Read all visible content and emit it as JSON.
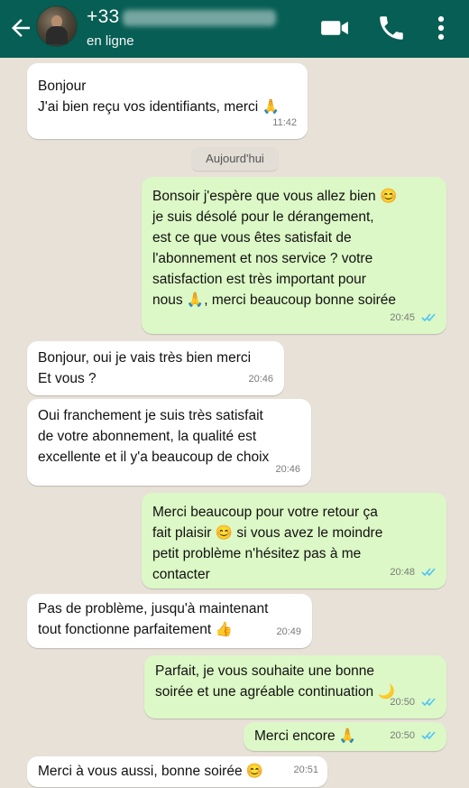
{
  "header": {
    "contact_name": "+33",
    "status": "en ligne"
  },
  "date_separator": "Aujourd'hui",
  "messages": [
    {
      "dir": "in",
      "text": "Bonjour\nJ'ai bien reçu vos identifiants, merci 🙏",
      "time": "11:42"
    },
    {
      "dir": "out",
      "text": "Bonsoir j'espère que vous allez bien 😊\nje suis désolé pour le dérangement,\nest ce que vous êtes satisfait de\nl'abonnement et nos service ? votre\nsatisfaction est très important pour\nnous 🙏, merci beaucoup bonne soirée",
      "time": "20:45"
    },
    {
      "dir": "in",
      "text": "Bonjour, oui je vais très bien merci\nEt vous ?",
      "time": "20:46"
    },
    {
      "dir": "in",
      "text": "Oui franchement je suis très satisfait\nde votre abonnement, la qualité est\nexcellente et il y'a beaucoup de choix",
      "time": "20:46"
    },
    {
      "dir": "out",
      "text": "Merci beaucoup pour votre retour ça\nfait plaisir 😊 si vous avez le moindre\npetit problème n'hésitez pas à me\ncontacter",
      "time": "20:48"
    },
    {
      "dir": "in",
      "text": "Pas de problème, jusqu'à maintenant\ntout fonctionne parfaitement 👍",
      "time": "20:49"
    },
    {
      "dir": "out",
      "text": "Parfait, je vous souhaite une bonne\nsoirée et une agréable continuation 🌙",
      "time": "20:50"
    },
    {
      "dir": "out",
      "text": "Merci encore 🙏",
      "time": "20:50"
    },
    {
      "dir": "in",
      "text": "Merci à vous aussi, bonne soirée 😊",
      "time": "20:51"
    }
  ],
  "colors": {
    "header": "#075e54",
    "incoming": "#ffffff",
    "outgoing": "#dcf8c6",
    "read_ticks": "#4fc3f7"
  },
  "icons": [
    "back-arrow-icon",
    "video-call-icon",
    "phone-icon",
    "more-options-icon",
    "double-check-icon"
  ]
}
